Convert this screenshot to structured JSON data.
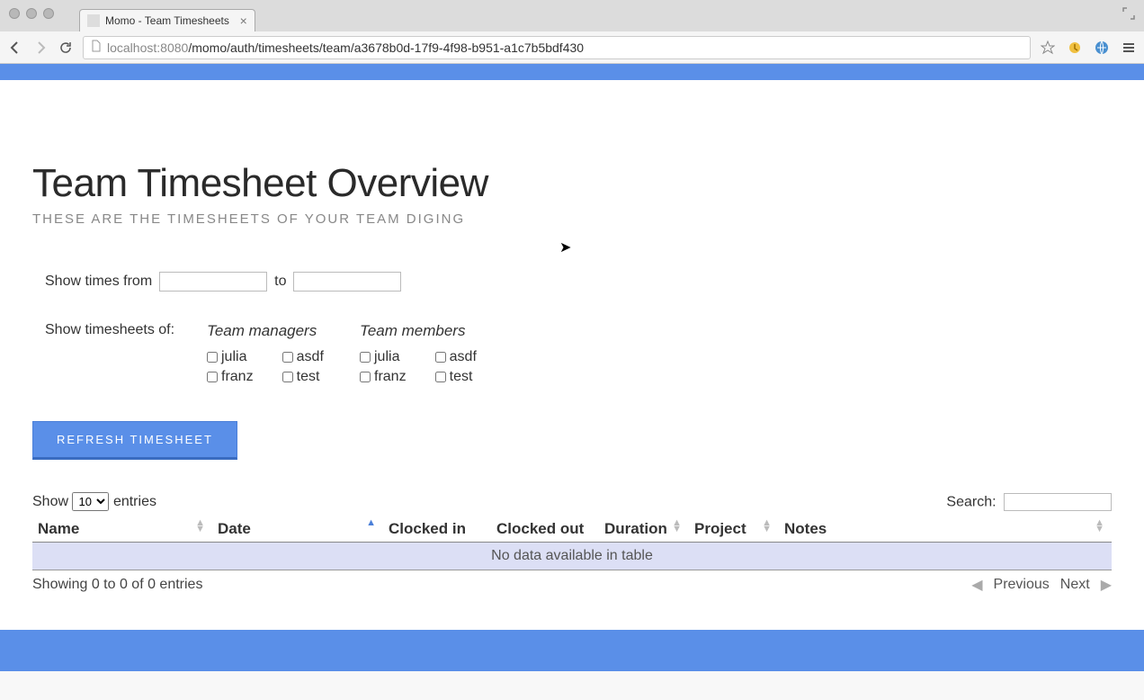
{
  "browser": {
    "tab_title": "Momo - Team Timesheets",
    "url_host": "localhost",
    "url_port": ":8080",
    "url_path": "/momo/auth/timesheets/team/a3678b0d-17f9-4f98-b951-a1c7b5bdf430"
  },
  "page": {
    "title": "Team Timesheet Overview",
    "subtitle": "THESE ARE THE TIMESHEETS OF YOUR TEAM DIGING"
  },
  "filters": {
    "range_label_from": "Show times from",
    "range_label_to": "to",
    "groups_label": "Show timesheets of:",
    "manager_header": "Team managers",
    "member_header": "Team members",
    "manager_users": [
      "julia",
      "asdf",
      "franz",
      "test"
    ],
    "member_users": [
      "julia",
      "asdf",
      "franz",
      "test"
    ]
  },
  "actions": {
    "refresh": "REFRESH TIMESHEET"
  },
  "table": {
    "show_prefix": "Show",
    "entries_suffix": "entries",
    "page_size": "10",
    "search_label": "Search:",
    "columns": {
      "name": "Name",
      "date": "Date",
      "clocked_in": "Clocked in",
      "clocked_out": "Clocked out",
      "duration": "Duration",
      "project": "Project",
      "notes": "Notes"
    },
    "empty": "No data available in table",
    "info": "Showing 0 to 0 of 0 entries",
    "prev": "Previous",
    "next": "Next"
  }
}
